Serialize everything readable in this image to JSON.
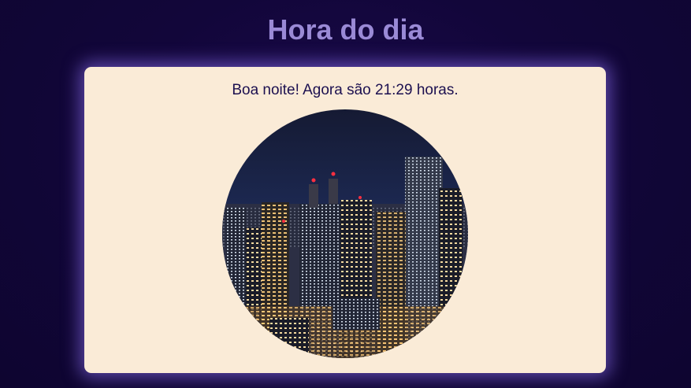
{
  "page": {
    "title": "Hora do dia"
  },
  "card": {
    "greeting": "Boa noite! Agora são 21:29 horas.",
    "image": "night-city-skyline"
  },
  "colors": {
    "background": "#12063a",
    "title": "#9a8ad6",
    "card": "#faebd7",
    "text": "#1c1050",
    "glow": "#9678ff"
  }
}
